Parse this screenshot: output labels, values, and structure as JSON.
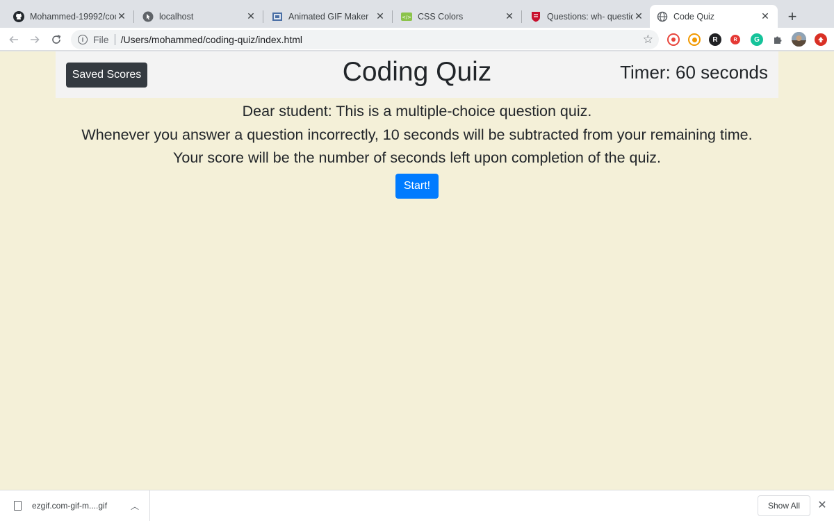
{
  "browser": {
    "tabs": [
      {
        "title": "Mohammed-19992/cod",
        "icon": "github-icon",
        "active": false
      },
      {
        "title": "localhost",
        "icon": "cursor-icon",
        "active": false
      },
      {
        "title": "Animated GIF Maker",
        "icon": "ezgif-icon",
        "active": false
      },
      {
        "title": "CSS Colors",
        "icon": "css-icon",
        "active": false
      },
      {
        "title": "Questions: wh- questio",
        "icon": "cambridge-icon",
        "active": false
      },
      {
        "title": "Code Quiz",
        "icon": "globe-icon",
        "active": true
      }
    ],
    "close_glyph": "✕",
    "new_tab_glyph": "+",
    "address": {
      "scheme_label": "File",
      "url": "/Users/mohammed/coding-quiz/index.html"
    },
    "extensions": [
      {
        "name": "screen-record-icon",
        "color": "#e8453c",
        "letter": ""
      },
      {
        "name": "honey-icon",
        "color": "#f29900",
        "letter": ""
      },
      {
        "name": "r-extension-icon",
        "color": "#202124",
        "letter": "R"
      },
      {
        "name": "red-extension-icon",
        "color": "#e53935",
        "letter": "R"
      },
      {
        "name": "grammarly-icon",
        "color": "#15c39a",
        "letter": "G"
      },
      {
        "name": "puzzle-icon",
        "color": "#5f6368",
        "letter": ""
      },
      {
        "name": "profile-avatar",
        "color": "#6b7b8c",
        "letter": ""
      },
      {
        "name": "update-icon",
        "color": "#d93025",
        "letter": ""
      }
    ]
  },
  "page": {
    "saved_scores_label": "Saved Scores",
    "title": "Coding Quiz",
    "timer_text": "Timer: 60 seconds",
    "intro_lines": [
      "Dear student: This is a multiple-choice question quiz.",
      "Whenever you answer a question incorrectly, 10 seconds will be subtracted from your remaining time.",
      "Your score will be the number of seconds left upon completion of the quiz."
    ],
    "start_label": "Start!",
    "colors": {
      "background": "#f4f0d8",
      "header": "#f3f3f3",
      "dark_button": "#343a40",
      "primary_button": "#007bff"
    }
  },
  "downloads": {
    "file_name": "ezgif.com-gif-m....gif",
    "show_all_label": "Show All"
  }
}
